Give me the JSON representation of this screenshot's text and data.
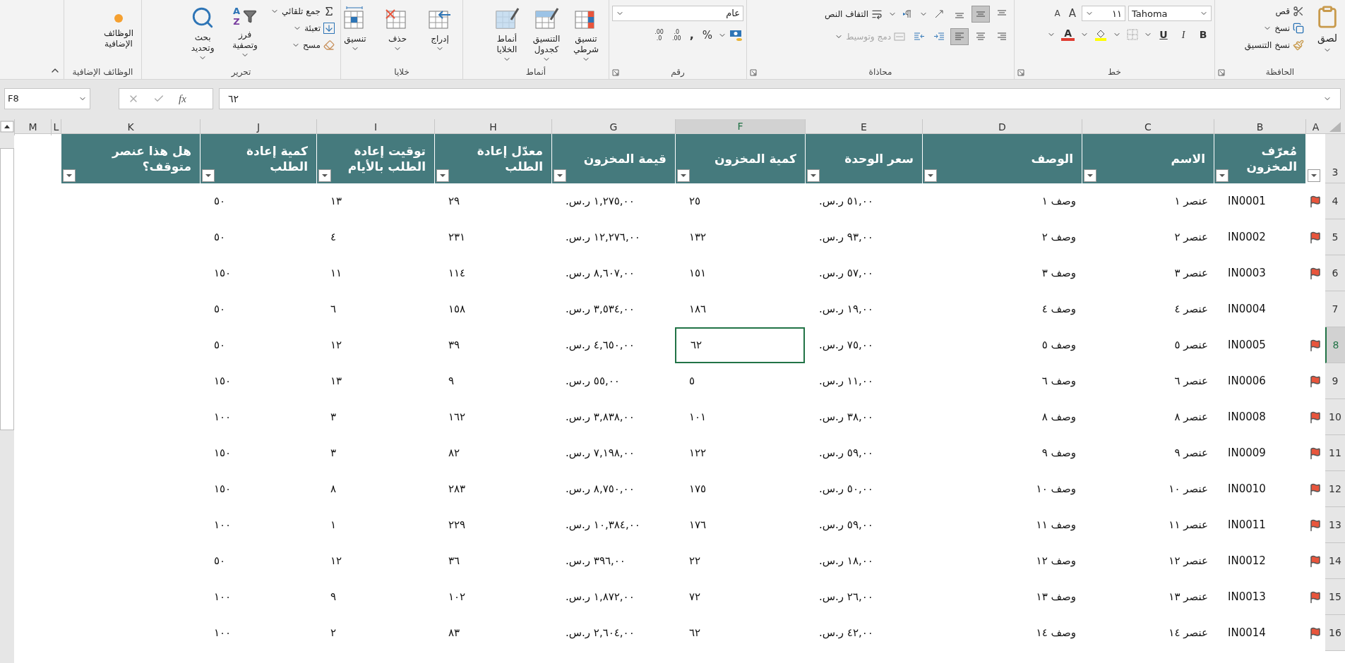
{
  "ribbon": {
    "clipboard": {
      "label": "الحافظة",
      "paste": "لصق",
      "cut": "قص",
      "copy": "نسخ",
      "format_painter": "نسخ التنسيق"
    },
    "font": {
      "label": "خط",
      "font_name": "Tahoma",
      "font_size": "١١",
      "grow": "A",
      "shrink": "A",
      "bold": "B",
      "italic": "I",
      "underline": "U",
      "font_color": "A"
    },
    "alignment": {
      "label": "محاذاة",
      "wrap_text": "التفاف النص",
      "merge": {
        "label": "دمج وتوسيط",
        "disabled": true
      },
      "vertical": [
        {
          "kind": "top",
          "selected": false
        },
        {
          "kind": "middle",
          "selected": true
        },
        {
          "kind": "bottom",
          "selected": false
        }
      ],
      "horizontal": [
        {
          "kind": "right",
          "selected": false
        },
        {
          "kind": "center",
          "selected": false
        },
        {
          "kind": "left",
          "selected": true
        }
      ]
    },
    "number": {
      "label": "رقم",
      "format": "عام",
      "percent": "%",
      "comma": ",",
      "decimals": [
        {
          "top": ".0",
          "bottom": ".00"
        },
        {
          "top": ".00",
          "bottom": ".0"
        }
      ]
    },
    "styles": {
      "label": "أنماط",
      "buttons": [
        {
          "kind": "conditional",
          "label": "تنسيق شرطي"
        },
        {
          "kind": "table",
          "label": "التنسيق كجدول"
        },
        {
          "kind": "cell",
          "label": "أنماط الخلايا"
        }
      ]
    },
    "cells": {
      "label": "خلايا",
      "buttons": [
        {
          "kind": "insert",
          "label": "إدراج"
        },
        {
          "kind": "delete",
          "label": "حذف"
        },
        {
          "kind": "format",
          "label": "تنسيق"
        }
      ]
    },
    "editing": {
      "label": "تحرير",
      "autosum": "جمع تلقائي",
      "fill": "تعبئة",
      "clear": "مسح",
      "sort": "فرز وتصفية",
      "sort_letters": [
        "A",
        "Z"
      ],
      "find": "بحث وتحديد"
    },
    "addins": {
      "label": "الوظائف الإضافية",
      "button": "الوظائف الإضافية"
    }
  },
  "formula_bar": {
    "name_box": "F8",
    "fx": "fx",
    "formula": "٦٢"
  },
  "sheet": {
    "columns": [
      {
        "letter": "A",
        "selected": false
      },
      {
        "letter": "B",
        "selected": false
      },
      {
        "letter": "C",
        "selected": false
      },
      {
        "letter": "D",
        "selected": false
      },
      {
        "letter": "E",
        "selected": false
      },
      {
        "letter": "F",
        "selected": true
      },
      {
        "letter": "G",
        "selected": false
      },
      {
        "letter": "H",
        "selected": false
      },
      {
        "letter": "I",
        "selected": false
      },
      {
        "letter": "J",
        "selected": false
      },
      {
        "letter": "K",
        "selected": false
      },
      {
        "letter": "L",
        "selected": false
      },
      {
        "letter": "M",
        "selected": false
      }
    ],
    "header_row_number": "3",
    "table_columns": [
      {
        "header": "مُعرّف المخزون",
        "kind": "number"
      },
      {
        "header": "الاسم",
        "kind": "text"
      },
      {
        "header": "الوصف",
        "kind": "text"
      },
      {
        "header": "سعر الوحدة",
        "kind": "number"
      },
      {
        "header": "كمية المخزون",
        "kind": "number"
      },
      {
        "header": "قيمة المخزون",
        "kind": "number"
      },
      {
        "header": "معدّل إعادة الطلب",
        "kind": "number"
      },
      {
        "header": "توقيت إعادة الطلب بالأيام",
        "kind": "number"
      },
      {
        "header": "كمية إعادة الطلب",
        "kind": "number"
      },
      {
        "header": "هل هذا عنصر متوقف؟",
        "kind": "text"
      }
    ],
    "rows": [
      {
        "number": "4",
        "selected": false,
        "flagged": true,
        "cells": [
          "",
          "IN0001",
          "عنصر ١",
          "وصف ١",
          "٥١,٠٠ ر.س.",
          "٢٥",
          "١,٢٧٥,٠٠ ر.س.",
          "٢٩",
          "١٣",
          "٥٠"
        ]
      },
      {
        "number": "5",
        "selected": false,
        "flagged": true,
        "cells": [
          "",
          "IN0002",
          "عنصر ٢",
          "وصف ٢",
          "٩٣,٠٠ ر.س.",
          "١٣٢",
          "١٢,٢٧٦,٠٠ ر.س.",
          "٢٣١",
          "٤",
          "٥٠"
        ]
      },
      {
        "number": "6",
        "selected": false,
        "flagged": true,
        "cells": [
          "",
          "IN0003",
          "عنصر ٣",
          "وصف ٣",
          "٥٧,٠٠ ر.س.",
          "١٥١",
          "٨,٦٠٧,٠٠ ر.س.",
          "١١٤",
          "١١",
          "١٥٠"
        ]
      },
      {
        "number": "7",
        "selected": false,
        "flagged": false,
        "cells": [
          "",
          "IN0004",
          "عنصر ٤",
          "وصف ٤",
          "١٩,٠٠ ر.س.",
          "١٨٦",
          "٣,٥٣٤,٠٠ ر.س.",
          "١٥٨",
          "٦",
          "٥٠"
        ]
      },
      {
        "number": "8",
        "selected": true,
        "flagged": true,
        "cells": [
          "",
          "IN0005",
          "عنصر ٥",
          "وصف ٥",
          "٧٥,٠٠ ر.س.",
          "٦٢",
          "٤,٦٥٠,٠٠ ر.س.",
          "٣٩",
          "١٢",
          "٥٠"
        ]
      },
      {
        "number": "9",
        "selected": false,
        "flagged": true,
        "cells": [
          "",
          "IN0006",
          "عنصر ٦",
          "وصف ٦",
          "١١,٠٠ ر.س.",
          "٥",
          "٥٥,٠٠ ر.س.",
          "٩",
          "١٣",
          "١٥٠"
        ]
      },
      {
        "number": "10",
        "selected": false,
        "flagged": true,
        "cells": [
          "",
          "IN0008",
          "عنصر ٨",
          "وصف ٨",
          "٣٨,٠٠ ر.س.",
          "١٠١",
          "٣,٨٣٨,٠٠ ر.س.",
          "١٦٢",
          "٣",
          "١٠٠"
        ]
      },
      {
        "number": "11",
        "selected": false,
        "flagged": true,
        "cells": [
          "",
          "IN0009",
          "عنصر ٩",
          "وصف ٩",
          "٥٩,٠٠ ر.س.",
          "١٢٢",
          "٧,١٩٨,٠٠ ر.س.",
          "٨٢",
          "٣",
          "١٥٠"
        ]
      },
      {
        "number": "12",
        "selected": false,
        "flagged": true,
        "cells": [
          "",
          "IN0010",
          "عنصر ١٠",
          "وصف ١٠",
          "٥٠,٠٠ ر.س.",
          "١٧٥",
          "٨,٧٥٠,٠٠ ر.س.",
          "٢٨٣",
          "٨",
          "١٥٠"
        ]
      },
      {
        "number": "13",
        "selected": false,
        "flagged": true,
        "cells": [
          "",
          "IN0011",
          "عنصر ١١",
          "وصف ١١",
          "٥٩,٠٠ ر.س.",
          "١٧٦",
          "١٠,٣٨٤,٠٠ ر.س.",
          "٢٢٩",
          "١",
          "١٠٠"
        ]
      },
      {
        "number": "14",
        "selected": false,
        "flagged": true,
        "cells": [
          "",
          "IN0012",
          "عنصر ١٢",
          "وصف ١٢",
          "١٨,٠٠ ر.س.",
          "٢٢",
          "٣٩٦,٠٠ ر.س.",
          "٣٦",
          "١٢",
          "٥٠"
        ]
      },
      {
        "number": "15",
        "selected": false,
        "flagged": true,
        "cells": [
          "",
          "IN0013",
          "عنصر ١٣",
          "وصف ١٣",
          "٢٦,٠٠ ر.س.",
          "٧٢",
          "١,٨٧٢,٠٠ ر.س.",
          "١٠٢",
          "٩",
          "١٠٠"
        ]
      },
      {
        "number": "16",
        "selected": false,
        "flagged": true,
        "cells": [
          "",
          "IN0014",
          "عنصر ١٤",
          "وصف ١٤",
          "٤٢,٠٠ ر.س.",
          "٦٢",
          "٢,٦٠٤,٠٠ ر.س.",
          "٨٣",
          "٢",
          "١٠٠"
        ]
      }
    ]
  }
}
